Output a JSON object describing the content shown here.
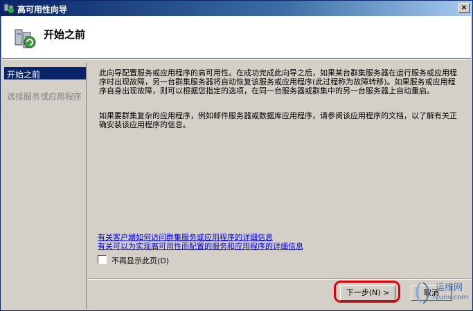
{
  "window": {
    "title": "高可用性向导",
    "close_label": "×"
  },
  "header": {
    "title": "开始之前"
  },
  "sidebar": {
    "items": [
      {
        "label": "开始之前",
        "state": "active"
      },
      {
        "label": "选择服务或应用程序",
        "state": "disabled"
      }
    ]
  },
  "content": {
    "paragraph1": "此向导配置服务或应用程序的高可用性。在成功完成此向导之后，如果某台群集服务器在运行服务或应用程序时出现故障，另一台群集服务器将自动恢复该服务或应用程序(此过程称为故障转移)。如果服务或应用程序自身出现故障，则可以根据您指定的选项，在同一台服务器或群集中的另一台服务器上自动重启。",
    "paragraph2": "如果要群集复杂的应用程序，例如邮件服务器或数据库应用程序，请参阅该应用程序的文档，以了解有关正确安装该应用程序的信息。",
    "link1": "有关客户端如何访问群集服务或应用程序的详细信息",
    "link2": "有关可以为实现高可用性而配置的服务和应用程序的详细信息",
    "checkbox_label": "不再显示此页(D)",
    "checkbox_checked": false
  },
  "buttons": {
    "next": "下一步(N) >",
    "cancel": "取消"
  },
  "watermark": {
    "text": "运维网",
    "url": "iyunv.com"
  },
  "colors": {
    "title_bar": "#0a246a",
    "selection": "#0a246a",
    "link": "#0000ee",
    "highlight": "#e0000a"
  }
}
